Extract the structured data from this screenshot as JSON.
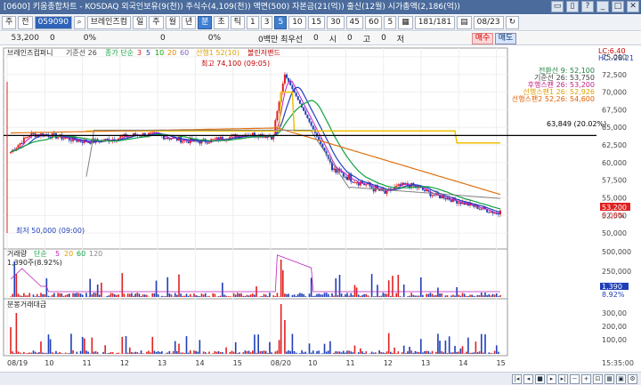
{
  "window": {
    "title": "[0600] 키움종합차트 - KOSDAQ 외국인보유(9(천)) 주식수(4,109(천)) 액면(500) 자본금(21(억)) 출신(12월) 시가총액(2,186(억))",
    "buttons": [
      "▭",
      "▯",
      "?",
      "_",
      "□",
      "✕"
    ]
  },
  "toolbar": {
    "market": "주",
    "prev": "전",
    "code": "059090",
    "stock_name": "브레인즈컴",
    "periods": [
      "일",
      "주",
      "월",
      "년",
      "분",
      "초",
      "틱"
    ],
    "selected_period": "분",
    "intervals": [
      "1",
      "3",
      "5",
      "10",
      "15",
      "30",
      "45",
      "60"
    ],
    "selected_interval": "5",
    "count_select": "5",
    "count": "181",
    "total": "181",
    "date": "08/23"
  },
  "quote": {
    "price": "53,200",
    "change": "0",
    "change_pct": "0%",
    "v1": "0",
    "v2": "0%",
    "volume_label": "0백만 최우선",
    "siga": "시",
    "siga_v": "0",
    "goga": "고",
    "goga_v": "0",
    "jeoga": "저",
    "jeoga_v": "0",
    "buy": "매수",
    "sell": "매도"
  },
  "price_panel": {
    "legend_title": "브레인즈컴퍼니",
    "legend_base": "기준선 26",
    "ma_label": "종가 단순",
    "ma_periods": [
      "3",
      "5",
      "10",
      "20",
      "60"
    ],
    "ma_colors": [
      "#d02020",
      "#2040c0",
      "#10a010",
      "#e08000",
      "#8060c0"
    ],
    "leading_label": "선행1 52(10)",
    "bollinger_label": "볼린저밴드",
    "right_top": "LC:6.40",
    "right_top2": "HC:-28.21",
    "high_label": "최고 74,100 (09:05)",
    "low_label": "최저 50,000 (09:00)",
    "hline_label": "63,849 (20.02%)",
    "current_tag": "53,200",
    "current_pct": "0.00%",
    "ichimoku": [
      {
        "text": "전환선 9: 52,100",
        "color": "#208040"
      },
      {
        "text": "기준선 26: 53,750",
        "color": "#404040"
      },
      {
        "text": "후행스팬 26: 53,200",
        "color": "#c02080"
      },
      {
        "text": "선행스팬1 26: 52,926",
        "color": "#e0a000"
      },
      {
        "text": "선행스팬2 52,26: 54,600",
        "color": "#e06000"
      }
    ],
    "y_ticks": [
      "75,000",
      "72,500",
      "70,000",
      "67,500",
      "65,000",
      "62,500",
      "60,000",
      "57,500",
      "55,000",
      "52,500",
      "50,000"
    ]
  },
  "volume_panel": {
    "legend": "거래량",
    "ma_label": "단순",
    "ma_periods": [
      "5",
      "20",
      "60",
      "120"
    ],
    "info": "1,390주(8.92%)",
    "y_ticks": [
      "500,000",
      "250,000"
    ],
    "current_tag": "1,390",
    "current_pct": "8.92%"
  },
  "amount_panel": {
    "legend": "분봉거래대금",
    "y_ticks": [
      "300,00",
      "200,00",
      "100,00"
    ]
  },
  "x_axis": {
    "labels": [
      "08/19",
      "10",
      "11",
      "12",
      "13",
      "14",
      "15",
      "08/20",
      "10",
      "11",
      "12",
      "13",
      "14",
      "15"
    ],
    "right_label": "15:35:00"
  },
  "chart_data": {
    "type": "candlestick",
    "hline": 63849,
    "price_range": [
      48000,
      76000
    ],
    "high": 74100,
    "low": 50000,
    "current": 53200
  },
  "colors": {
    "up": "#e02020",
    "down": "#1f3fb8",
    "ma5": "#c020c0",
    "ma10": "#2040c0",
    "ma20": "#10a040",
    "leading1": "#f0c000",
    "leading2": "#e07010",
    "base": "#808080"
  }
}
